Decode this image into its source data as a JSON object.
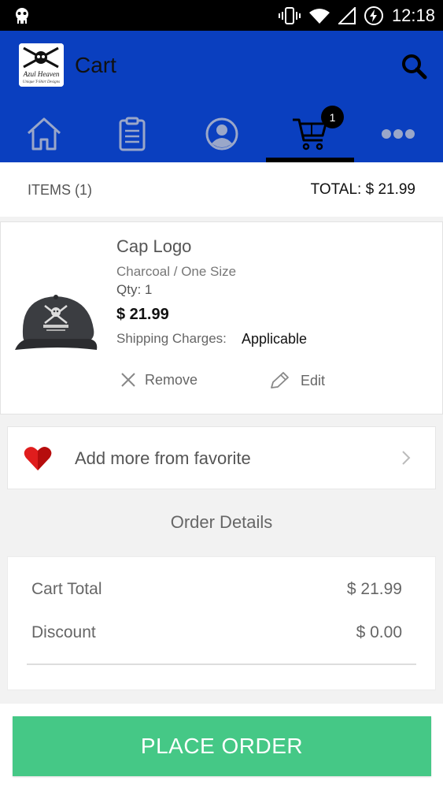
{
  "status_bar": {
    "time": "12:18"
  },
  "app_bar": {
    "title": "Cart",
    "logo_text_line1": "Azul Heaven",
    "logo_text_line2": "Unique T-Shirt Designs",
    "cart_badge": "1",
    "tabs": [
      "home",
      "orders",
      "account",
      "cart",
      "more"
    ],
    "active_tab": "cart",
    "colors": {
      "bar": "#0a3fbf",
      "icons": "#9aa7c9"
    }
  },
  "summary": {
    "items_label": "ITEMS (1)",
    "total_label": "TOTAL: $ 21.99"
  },
  "cart_item": {
    "name": "Cap Logo",
    "variant": "Charcoal / One Size",
    "qty": "Qty: 1",
    "price": "$ 21.99",
    "shipping_label": "Shipping Charges:",
    "shipping_value": "Applicable",
    "remove_label": "Remove",
    "edit_label": "Edit"
  },
  "favorite": {
    "label": "Add more from favorite",
    "heart_color": "#e01d1d"
  },
  "order_details": {
    "title": "Order Details",
    "rows": [
      {
        "label": "Cart Total",
        "value": "$ 21.99"
      },
      {
        "label": "Discount",
        "value": "$ 0.00"
      }
    ]
  },
  "place_order": {
    "label": "PLACE ORDER",
    "color": "#45c886"
  }
}
